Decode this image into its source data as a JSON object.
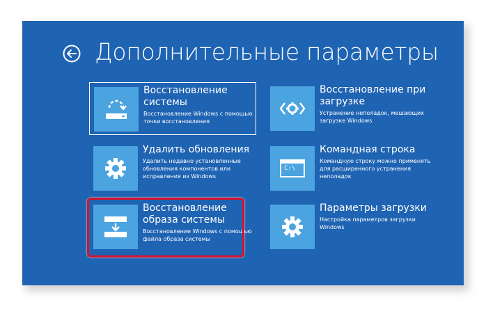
{
  "page": {
    "title": "Дополнительные параметры",
    "back_icon": "back-arrow-circle-icon"
  },
  "tiles": [
    {
      "title": "Восстановление системы",
      "description": "Восстановление Windows с помощью точки восстановления",
      "icon": "system-restore-icon",
      "selected": true
    },
    {
      "title": "Восстановление при загрузке",
      "description": "Устранение неполадок, мешающих загрузке Windows",
      "icon": "startup-repair-icon",
      "selected": false
    },
    {
      "title": "Удалить обновления",
      "description": "Удалить недавно установленные обновления компонентов или исправления из Windows",
      "icon": "gear-icon",
      "selected": false
    },
    {
      "title": "Командная строка",
      "description": "Командную строку можно применять для расширенного устранения неполадок",
      "icon": "command-prompt-icon",
      "icon_text": "C:\\",
      "selected": false
    },
    {
      "title": "Восстановление образа системы",
      "description": "Восстановление Windows с помощью файла образа системы",
      "icon": "system-image-icon",
      "selected": false,
      "highlighted": true
    },
    {
      "title": "Параметры загрузки",
      "description": "Настройка параметров загрузки Windows",
      "icon": "gear-icon",
      "selected": false
    }
  ],
  "colors": {
    "screen_bg": "#1f63b3",
    "tile_icon_bg": "#4ba3e0",
    "highlight": "#d8112a"
  }
}
